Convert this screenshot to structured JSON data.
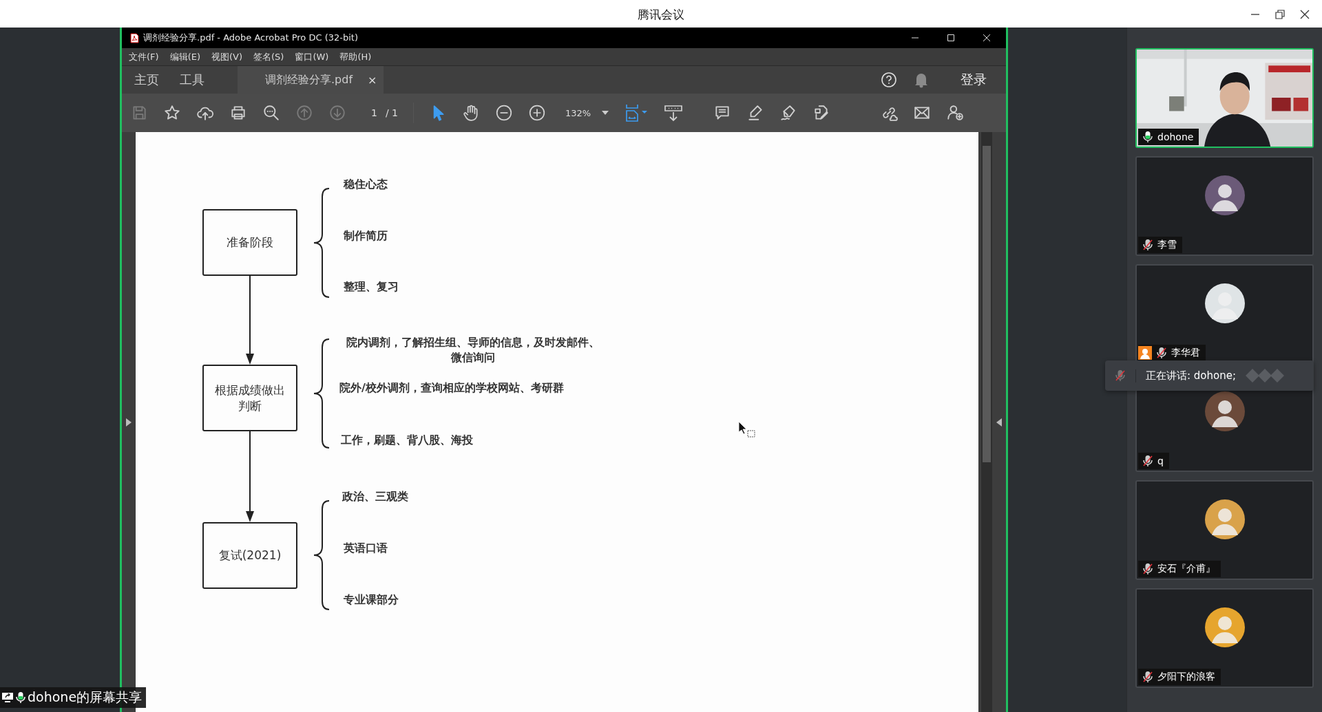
{
  "app_title": "腾讯会议",
  "acrobat": {
    "title": "调剂经验分享.pdf - Adobe Acrobat Pro DC (32-bit)",
    "menu": [
      "文件(F)",
      "编辑(E)",
      "视图(V)",
      "签名(S)",
      "窗口(W)",
      "帮助(H)"
    ],
    "nav_tabs": [
      "主页",
      "工具"
    ],
    "doc_tab": {
      "label": "调剂经验分享.pdf",
      "close": "×"
    },
    "login": "登录",
    "page_current": "1",
    "page_total": "/ 1",
    "zoom": "132%",
    "tools": [
      {
        "kind": "select",
        "selected": true
      },
      {
        "kind": "hand",
        "selected": false
      }
    ]
  },
  "diagram": {
    "stages": [
      {
        "label": "准备阶段",
        "items": [
          "稳住心态",
          "制作简历",
          "整理、复习"
        ]
      },
      {
        "label": "根据成绩做出判断",
        "items": [
          "院内调剂，了解招生组、导师的信息，及时发邮件、微信询问",
          "院外/校外调剂，查询相应的学校网站、考研群",
          "工作，刷题、背八股、海投"
        ]
      },
      {
        "label": "复试(2021)",
        "items": [
          "政治、三观类",
          "英语口语",
          "专业课部分"
        ]
      }
    ]
  },
  "participants": [
    {
      "name": "dohone",
      "kind": "video",
      "muted": false,
      "speaking": true,
      "host_icon": false
    },
    {
      "name": "李雪",
      "kind": "avatar",
      "muted": true,
      "speaking": false,
      "host_icon": false,
      "color": "#6b5a78"
    },
    {
      "name": "李华君",
      "kind": "avatar",
      "muted": true,
      "speaking": false,
      "host_icon": true,
      "color": "#dfe4e6"
    },
    {
      "name": "q",
      "kind": "avatar",
      "muted": true,
      "speaking": false,
      "host_icon": false,
      "color": "#6b4a3a"
    },
    {
      "name": "安石『介甫』",
      "kind": "avatar",
      "muted": true,
      "speaking": false,
      "host_icon": false,
      "color": "#d9a24a"
    },
    {
      "name": "夕阳下的浪客",
      "kind": "avatar",
      "muted": true,
      "speaking": false,
      "host_icon": false,
      "color": "#e6a52e"
    }
  ],
  "speaking_banner": {
    "text": "正在讲话: dohone;"
  },
  "share_label": "dohone的屏幕共享"
}
